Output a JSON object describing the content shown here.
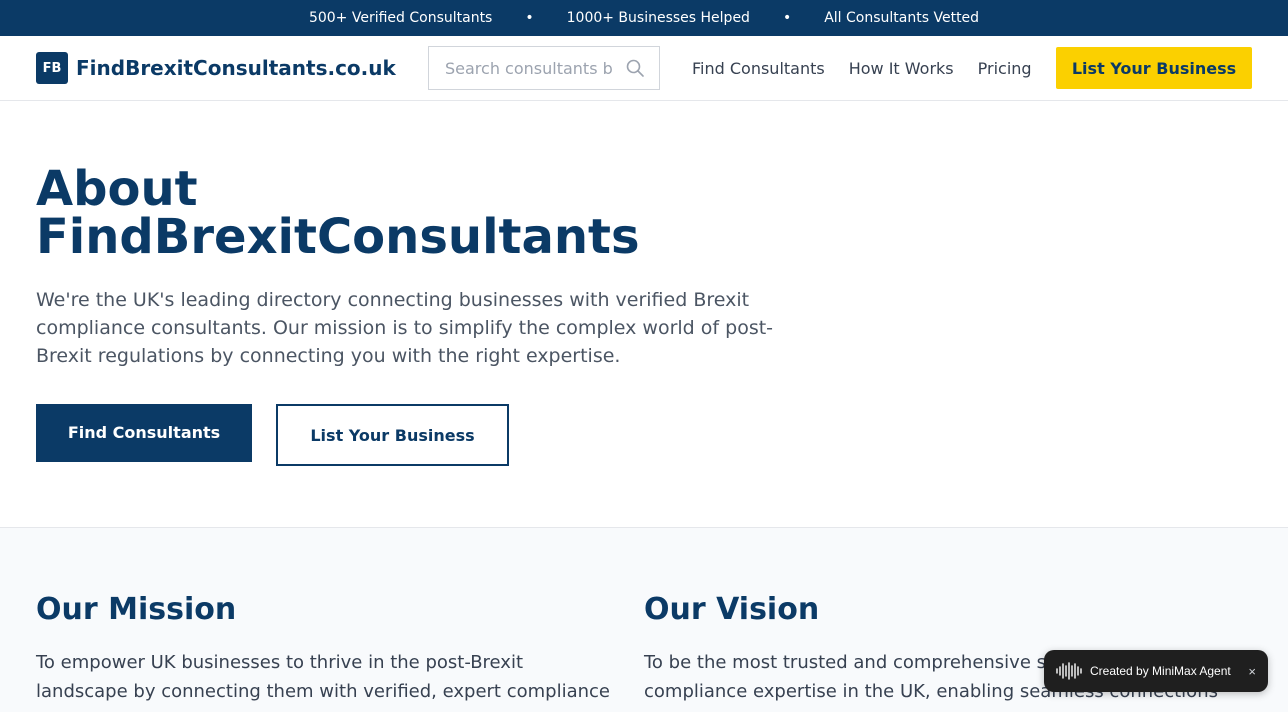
{
  "topbar": {
    "items": [
      "500+ Verified Consultants",
      "1000+ Businesses Helped",
      "All Consultants Vetted"
    ],
    "separator": "•"
  },
  "header": {
    "logo_badge": "FB",
    "logo_text": "FindBrexitConsultants.co.uk",
    "search_placeholder": "Search consultants by",
    "search_icon": "search-icon",
    "nav": [
      "Find Consultants",
      "How It Works",
      "Pricing"
    ],
    "cta_label": "List Your Business"
  },
  "hero": {
    "title": "About FindBrexitConsultants",
    "description": "We're the UK's leading directory connecting businesses with verified Brexit compliance consultants. Our mission is to simplify the complex world of post-Brexit regulations by connecting you with the right expertise.",
    "primary_button": "Find Consultants",
    "secondary_button": "List Your Business"
  },
  "mission": {
    "title": "Our Mission",
    "text": "To empower UK businesses to thrive in the post-Brexit landscape by connecting them with verified, expert compliance"
  },
  "vision": {
    "title": "Our Vision",
    "text": "To be the most trusted and comprehensive source of Brexit compliance expertise in the UK, enabling seamless connections"
  },
  "badge": {
    "label": "Created by MiniMax Agent",
    "close": "×",
    "icon": "waveform-icon"
  },
  "colors": {
    "brand": "#0b3a66",
    "accent": "#fbd000",
    "section_bg": "#f8fafc"
  }
}
